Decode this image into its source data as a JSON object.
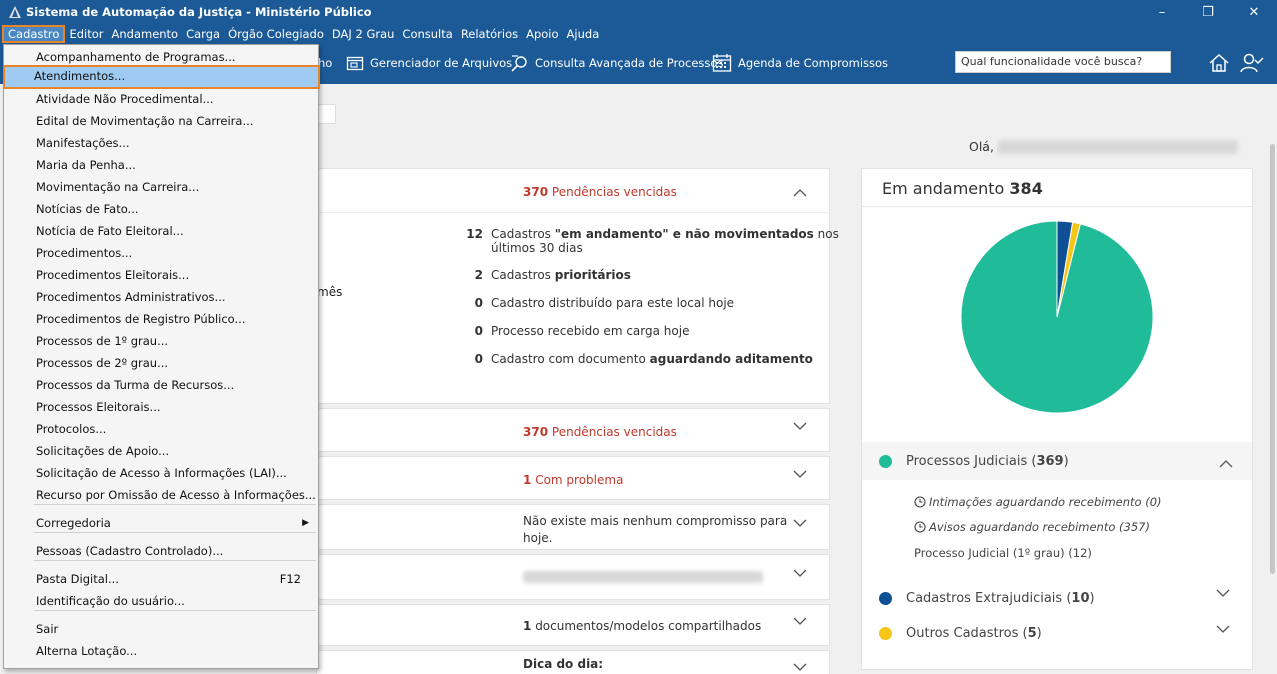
{
  "window": {
    "title": "Sistema de Automação da Justiça - Ministério Público",
    "minimize": "–",
    "maximize": "❐",
    "close": "✕"
  },
  "menubar": [
    "Cadastro",
    "Editor",
    "Andamento",
    "Carga",
    "Órgão Colegiado",
    "DAJ 2 Grau",
    "Consulta",
    "Relatórios",
    "Apoio",
    "Ajuda"
  ],
  "toolbar": {
    "partial_label": "ho",
    "file_manager": "Gerenciador de Arquivos",
    "advanced_search": "Consulta Avançada de Processos",
    "agenda": "Agenda de Compromissos",
    "search_placeholder": "Qual funcionalidade você busca?"
  },
  "greeting": "Olá,",
  "dropdown": {
    "items": [
      {
        "label": "Acompanhamento de Programas..."
      },
      {
        "label": "Atendimentos...",
        "highlighted": true
      },
      {
        "label": "Atividade Não Procedimental..."
      },
      {
        "label": "Edital de Movimentação na Carreira..."
      },
      {
        "label": "Manifestações..."
      },
      {
        "label": "Maria da Penha..."
      },
      {
        "label": "Movimentação na Carreira..."
      },
      {
        "label": "Notícias de Fato..."
      },
      {
        "label": "Notícia de Fato Eleitoral..."
      },
      {
        "label": "Procedimentos..."
      },
      {
        "label": "Procedimentos Eleitorais..."
      },
      {
        "label": "Procedimentos Administrativos..."
      },
      {
        "label": "Procedimentos de Registro Público..."
      },
      {
        "label": "Processos de 1º grau..."
      },
      {
        "label": "Processos de 2º grau..."
      },
      {
        "label": "Processos da Turma de Recursos..."
      },
      {
        "label": "Processos Eleitorais..."
      },
      {
        "label": "Protocolos..."
      },
      {
        "label": "Solicitações de Apoio..."
      },
      {
        "label": "Solicitação de Acesso à Informações (LAI)..."
      },
      {
        "label": "Recurso por Omissão de Acesso à Informações..."
      },
      {
        "label": "Corregedoria",
        "submenu": true
      },
      {
        "label": "Pessoas (Cadastro Controlado)..."
      },
      {
        "label": "Pasta Digital...",
        "shortcut": "F12"
      },
      {
        "label": "Identificação do usuário..."
      },
      {
        "label": "Sair"
      },
      {
        "label": "Alterna Lotação..."
      }
    ]
  },
  "panels": {
    "p1_header": {
      "count": "370",
      "text": "Pendências vencidas"
    },
    "p1_partial": "mês",
    "p1_rows": [
      {
        "num": "12",
        "pre": "Cadastros ",
        "bold": "\"em andamento\" e não movimentados",
        "post": " nos",
        "line2": "últimos 30 dias"
      },
      {
        "num": "2",
        "pre": "Cadastros ",
        "bold": "prioritários",
        "post": ""
      },
      {
        "num": "0",
        "pre": "Cadastro distribuído para este local hoje",
        "bold": "",
        "post": ""
      },
      {
        "num": "0",
        "pre": "Processo recebido em carga hoje",
        "bold": "",
        "post": ""
      },
      {
        "num": "0",
        "pre": "Cadastro com documento ",
        "bold": "aguardando aditamento",
        "post": ""
      }
    ],
    "p2": {
      "count": "370",
      "text": "Pendências vencidas"
    },
    "p3": {
      "count": "1",
      "text": "Com problema"
    },
    "p4": {
      "line1": "Não existe mais nenhum compromisso para",
      "line2": "hoje."
    },
    "p6": {
      "count": "1",
      "text": "documentos/modelos compartilhados"
    },
    "p7": {
      "text": "Dica do dia:"
    }
  },
  "right_panel": {
    "title": "Em andamento",
    "total": "384",
    "groups": [
      {
        "name": "Processos Judiciais",
        "count": "369",
        "color": "#20bc9a"
      },
      {
        "name": "Cadastros Extrajudiciais",
        "count": "10",
        "color": "#0f4f94"
      },
      {
        "name": "Outros Cadastros",
        "count": "5",
        "color": "#f5c518"
      }
    ],
    "sub_items": [
      "Intimações aguardando recebimento (0)",
      "Avisos aguardando recebimento (357)",
      "Processo Judicial (1º grau) (12)"
    ]
  },
  "chart_data": {
    "type": "pie",
    "categories": [
      "Processos Judiciais",
      "Cadastros Extrajudiciais",
      "Outros Cadastros"
    ],
    "values": [
      369,
      10,
      5
    ],
    "colors": [
      "#20bc9a",
      "#0f4f94",
      "#f5c518"
    ],
    "title": "Em andamento 384"
  }
}
